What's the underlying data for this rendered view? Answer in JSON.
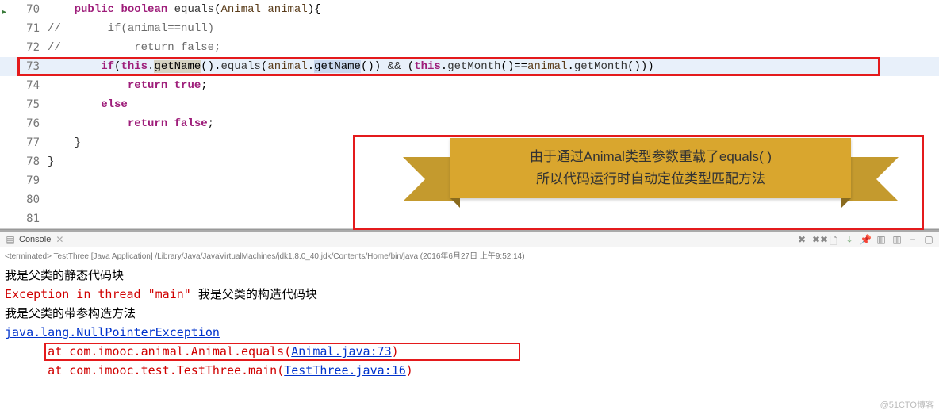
{
  "editor": {
    "lines": [
      {
        "num": "70",
        "marker": true
      },
      {
        "num": "71"
      },
      {
        "num": "72"
      },
      {
        "num": "73",
        "highlighted": true
      },
      {
        "num": "74"
      },
      {
        "num": "75"
      },
      {
        "num": "76"
      },
      {
        "num": "77"
      },
      {
        "num": "78"
      },
      {
        "num": "79"
      },
      {
        "num": "80"
      },
      {
        "num": "81"
      }
    ],
    "code": {
      "l70_kw1": "public",
      "l70_kw2": "boolean",
      "l70_method": "equals",
      "l70_type": "Animal",
      "l70_param": "animal",
      "l71_comment": "//       if(animal==null)",
      "l72_comment": "//           return false;",
      "l73_kw_if": "if",
      "l73_this1": "this",
      "l73_getName1": "getName",
      "l73_equals": "equals",
      "l73_animal1": "animal",
      "l73_getName2": "getName",
      "l73_and": "&&",
      "l73_this2": "this",
      "l73_getMonth1": "getMonth",
      "l73_animal2": "animal",
      "l73_getMonth2": "getMonth",
      "l74_kw": "return",
      "l74_true": "true",
      "l75_kw": "else",
      "l76_kw": "return",
      "l76_false": "false",
      "l77_brace": "}",
      "l78_brace": "}"
    }
  },
  "banner": {
    "line1": "由于通过Animal类型参数重载了equals( )",
    "line2": "所以代码运行时自动定位类型匹配方法"
  },
  "console": {
    "tab_label": "Console",
    "status": "<terminated> TestThree [Java Application] /Library/Java/JavaVirtualMachines/jdk1.8.0_40.jdk/Contents/Home/bin/java (2016年6月27日 上午9:52:14)",
    "lines": {
      "l1": "我是父类的静态代码块",
      "l2_err": "Exception in thread \"main\" ",
      "l2_txt": "我是父类的构造代码块",
      "l3": "我是父类的带参构造方法",
      "l4_link": "java.lang.NullPointerException",
      "l5_prefix": "      at com.imooc.animal.Animal.equals(",
      "l5_link": "Animal.java:73",
      "l5_suffix": ")",
      "l6_prefix": "      at com.imooc.test.TestThree.main(",
      "l6_link": "TestThree.java:16",
      "l6_suffix": ")"
    }
  },
  "watermark": "@51CTO博客"
}
